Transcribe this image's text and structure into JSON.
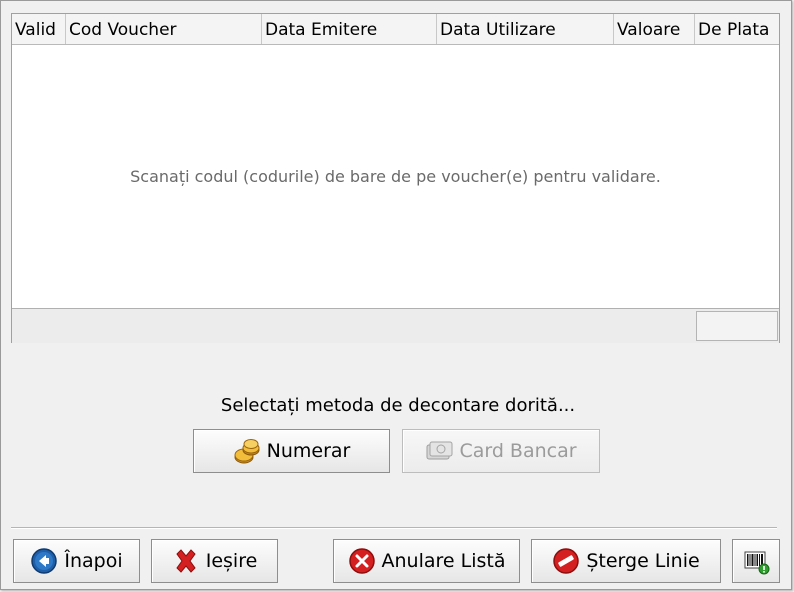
{
  "grid": {
    "columns": [
      "Valid",
      "Cod Voucher",
      "Data Emitere",
      "Data Utilizare",
      "Valoare",
      "De Plata"
    ],
    "empty_message": "Scanați codul (codurile) de bare de pe voucher(e) pentru validare."
  },
  "payment": {
    "prompt": "Selectați metoda de decontare dorită...",
    "cash_label": "Numerar",
    "card_label": "Card Bancar"
  },
  "bottom": {
    "back_label": "Înapoi",
    "exit_label": "Ieșire",
    "cancel_list_label": "Anulare Listă",
    "delete_line_label": "Șterge Linie"
  },
  "icons": {
    "back": "back-arrow-icon",
    "exit": "red-x-icon",
    "cancel_list": "red-circle-x-icon",
    "delete_line": "no-entry-icon",
    "barcode": "barcode-icon",
    "cash": "coins-icon",
    "card": "bank-card-icon"
  },
  "colors": {
    "accent_blue": "#1f5fa8",
    "danger_red": "#d42020",
    "coin_gold": "#e0a21a"
  }
}
